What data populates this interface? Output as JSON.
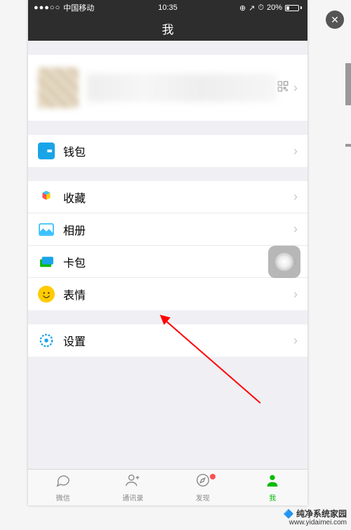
{
  "status": {
    "signal_dots": "●●●○○",
    "carrier": "中国移动",
    "time": "10:35",
    "lock": "⊕",
    "location": "➤",
    "alarm": "⏰",
    "battery_pct": "20%"
  },
  "nav": {
    "title": "我"
  },
  "menu": {
    "wallet": "钱包",
    "favorites": "收藏",
    "album": "相册",
    "cards": "卡包",
    "stickers": "表情",
    "settings": "设置"
  },
  "tabs": {
    "chat": "微信",
    "contacts": "通讯录",
    "discover": "发现",
    "me": "我"
  },
  "watermark": {
    "brand": "纯净系统家园",
    "url": "www.yidaimei.com"
  }
}
